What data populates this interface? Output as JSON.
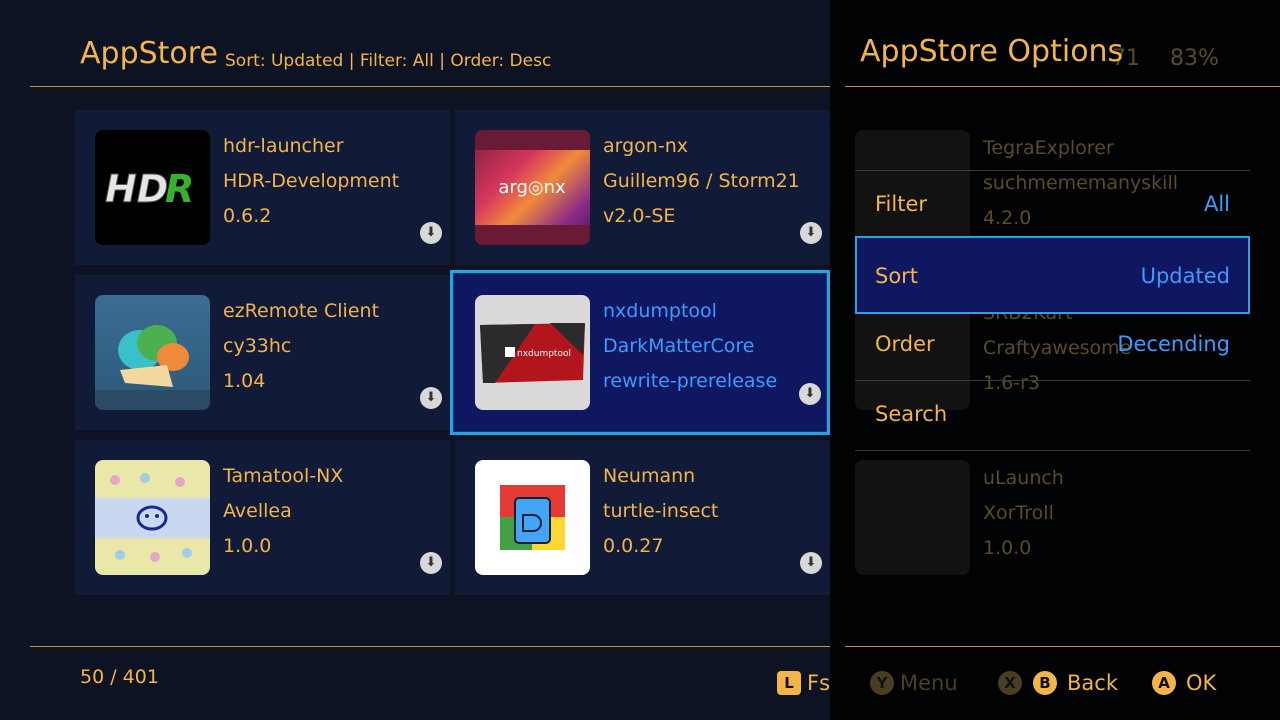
{
  "header": {
    "title": "AppStore",
    "subtitle": "Sort: Updated | Filter: All | Order: Desc"
  },
  "apps": [
    {
      "name": "hdr-launcher",
      "author": "HDR-Development",
      "version": "0.6.2",
      "icon": "hdr-logo"
    },
    {
      "name": "argon-nx",
      "author": "Guillem96 / Storm21",
      "version": "v2.0-SE",
      "icon": "argon-logo"
    },
    {
      "name": "ezRemote Client",
      "author": "cy33hc",
      "version": "1.04",
      "icon": "cloud-logo"
    },
    {
      "name": "nxdumptool",
      "author": "DarkMatterCore",
      "version": "rewrite-prerelease",
      "icon": "nxdumptool-logo"
    },
    {
      "name": "Tamatool-NX",
      "author": "Avellea",
      "version": "1.0.0",
      "icon": "tamagotchi-logo"
    },
    {
      "name": "Neumann",
      "author": "turtle-insect",
      "version": "0.0.27",
      "icon": "sdcard-logo"
    }
  ],
  "footer": {
    "counter": "50 / 401",
    "fs_label": "Fs",
    "menu_label": "Menu",
    "back_label": "Back",
    "ok_label": "OK",
    "l_key": "L",
    "y_key": "Y",
    "x_key": "X",
    "b_key": "B",
    "a_key": "A"
  },
  "panel": {
    "title": "AppStore Options",
    "options": [
      {
        "name": "Filter",
        "value": "All"
      },
      {
        "name": "Sort",
        "value": "Updated"
      },
      {
        "name": "Order",
        "value": "Decending"
      },
      {
        "name": "Search",
        "value": ""
      }
    ]
  },
  "background_ghost": {
    "status_a": "71",
    "status_b": "83%",
    "apps": [
      {
        "name": "TegraExplorer",
        "author": "suchmememanyskill",
        "version": "4.2.0"
      },
      {
        "name": "SRB2Kart",
        "author": "Craftyawesome",
        "version": "1.6-r3"
      },
      {
        "name": "uLaunch",
        "author": "XorTroll",
        "version": "1.0.0"
      }
    ]
  },
  "colors": {
    "accent": "#f3b44a",
    "selection_border": "#2aa1e6",
    "selection_bg": "#0f1760",
    "value_blue": "#3d9bff",
    "background": "#0e1323"
  }
}
